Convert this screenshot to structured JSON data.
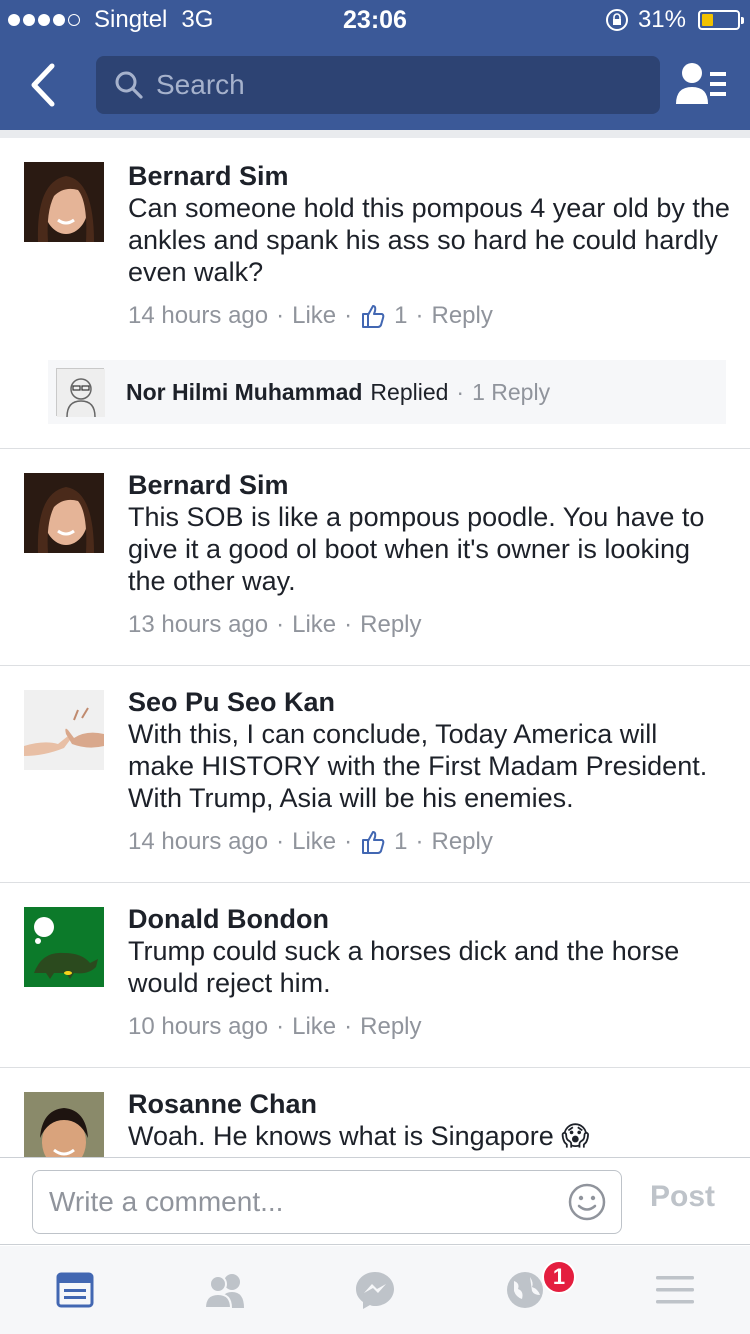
{
  "status_bar": {
    "carrier": "Singtel",
    "network": "3G",
    "time": "23:06",
    "battery": "31%",
    "battery_level": 0.31,
    "signal_bars": 4
  },
  "navbar": {
    "search_placeholder": "Search"
  },
  "comments": [
    {
      "author": "Bernard Sim",
      "text": "Can someone hold this pompous 4 year old by the ankles and spank his ass so hard he could hardly even walk?",
      "time": "14 hours ago",
      "like_label": "Like",
      "like_count": "1",
      "reply_label": "Reply",
      "reply_summary": {
        "author": "Nor Hilmi Muhammad",
        "action": "Replied",
        "count_label": "1 Reply"
      }
    },
    {
      "author": "Bernard Sim",
      "text": "This SOB is like a pompous poodle. You have to give it a good ol boot when it's owner is looking the other way.",
      "time": "13 hours ago",
      "like_label": "Like",
      "reply_label": "Reply"
    },
    {
      "author": "Seo Pu Seo Kan",
      "text": "With this, I can conclude, Today America will make HISTORY with the First Madam President. With Trump, Asia will be his enemies.",
      "time": "14 hours ago",
      "like_label": "Like",
      "like_count": "1",
      "reply_label": "Reply"
    },
    {
      "author": "Donald Bondon",
      "text": "Trump could suck a horses dick and the horse would reject him.",
      "time": "10 hours ago",
      "like_label": "Like",
      "reply_label": "Reply"
    },
    {
      "author": "Rosanne Chan",
      "text": "Woah. He knows what is Singapore 😱"
    }
  ],
  "composer": {
    "placeholder": "Write a comment...",
    "post_label": "Post"
  },
  "tabbar": {
    "notification_badge": "1"
  },
  "colors": {
    "brand": "#3b5998",
    "meta_gray": "#90949c",
    "badge_red": "#e41e3f",
    "active_tab": "#4267b2"
  }
}
